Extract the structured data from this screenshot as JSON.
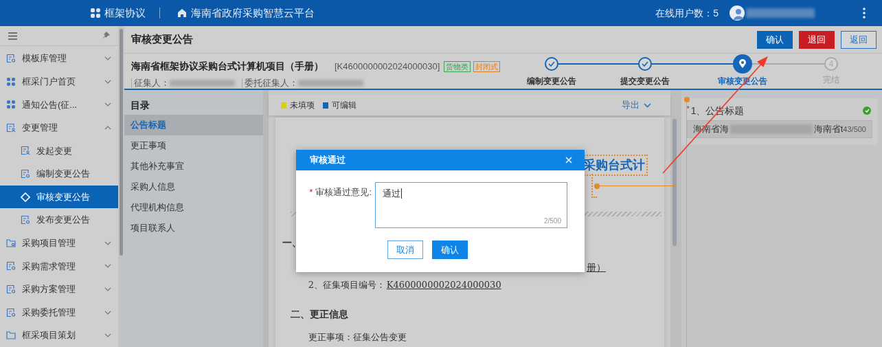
{
  "header": {
    "app_name": "框架协议",
    "platform": "海南省政府采购智慧云平台",
    "online_users": "在线用户数：5"
  },
  "sidebar": {
    "items": [
      {
        "label": "模板库管理",
        "expanded": false,
        "selected": false
      },
      {
        "label": "框采门户首页",
        "expanded": false,
        "selected": false
      },
      {
        "label": "通知公告(征...",
        "expanded": false,
        "selected": false
      },
      {
        "label": "变更管理",
        "expanded": true,
        "selected": false,
        "children": [
          {
            "label": "发起变更",
            "selected": false
          },
          {
            "label": "编制变更公告",
            "selected": false
          },
          {
            "label": "审核变更公告",
            "selected": true
          },
          {
            "label": "发布变更公告",
            "selected": false
          }
        ]
      },
      {
        "label": "采购项目管理",
        "expanded": false,
        "selected": false
      },
      {
        "label": "采购需求管理",
        "expanded": false,
        "selected": false
      },
      {
        "label": "采购方案管理",
        "expanded": false,
        "selected": false
      },
      {
        "label": "采购委托管理",
        "expanded": false,
        "selected": false
      },
      {
        "label": "框采项目策划",
        "expanded": false,
        "selected": false
      }
    ]
  },
  "page": {
    "title": "审核变更公告",
    "buttons": [
      {
        "label": "确认",
        "kind": "primary"
      },
      {
        "label": "退回",
        "kind": "danger"
      },
      {
        "label": "返回",
        "kind": "outline"
      }
    ]
  },
  "project": {
    "name": "海南省框架协议采购台式计算机项目（手册）",
    "code": "[K4600000002024000030]",
    "tags": [
      {
        "label": "货物类",
        "color": "#3aa655"
      },
      {
        "label": "封闭式",
        "color": "#e07b1f"
      }
    ],
    "meta": [
      {
        "label": "征集人："
      },
      {
        "label": "委托征集人："
      }
    ]
  },
  "steps": [
    {
      "label": "编制变更公告",
      "completed": true,
      "selected": false
    },
    {
      "label": "提交变更公告",
      "completed": true,
      "selected": false
    },
    {
      "label": "审核变更公告",
      "completed": false,
      "selected": true
    },
    {
      "label": "完结",
      "completed": false,
      "selected": false,
      "number": "4"
    }
  ],
  "directory": {
    "title": "目录",
    "items": [
      {
        "label": "公告标题",
        "selected": true
      },
      {
        "label": "更正事项",
        "selected": false
      },
      {
        "label": "其他补充事宜",
        "selected": false
      },
      {
        "label": "采购人信息",
        "selected": false
      },
      {
        "label": "代理机构信息",
        "selected": false
      },
      {
        "label": "项目联系人",
        "selected": false
      }
    ]
  },
  "legend": [
    {
      "label": "未填项",
      "color": "#d4d400"
    },
    {
      "label": "可编辑",
      "color": "#0a67c2"
    }
  ],
  "export": "导出",
  "document": {
    "title_right": "采购台式计",
    "section_1_mark": "一、",
    "line_1_tail": "册）",
    "line_2": "2、征集项目编号：",
    "line_2_value": "K4600000002024000030",
    "section_2": "二、更正信息",
    "line_3": "更正事项：征集公告变更"
  },
  "fields": [
    {
      "label": "1、公告标题",
      "required_mark": "*",
      "valid": true,
      "value_start": "海南省海",
      "value_end": "海南省t",
      "count": "43/500"
    }
  ],
  "dialog": {
    "title": "审核通过",
    "label": "审核通过意见:",
    "required_mark": "*",
    "value": "通过",
    "count": "2/500",
    "buttons": [
      {
        "label": "取消",
        "kind": "outline"
      },
      {
        "label": "确认",
        "kind": "primary"
      }
    ]
  }
}
